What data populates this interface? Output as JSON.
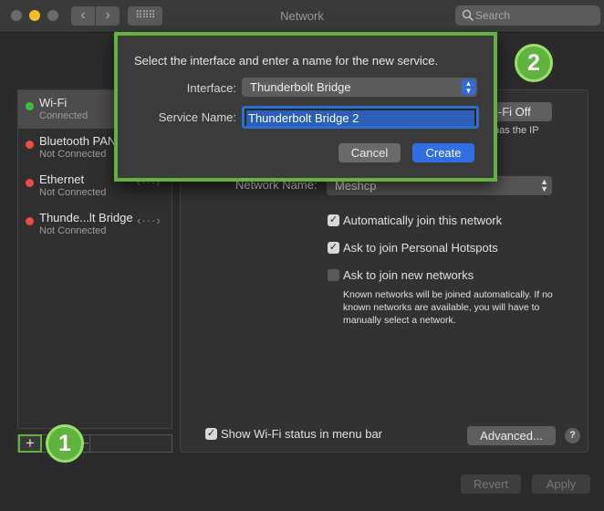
{
  "window": {
    "title": "Network",
    "search_placeholder": "Search"
  },
  "toolbar": {
    "back_glyph": "‹",
    "forward_glyph": "›",
    "grid_glyph": "⠿⠿⠿"
  },
  "sidebar": {
    "items": [
      {
        "name": "Wi-Fi",
        "status": "Connected",
        "status_color": "#36c240",
        "selected": true
      },
      {
        "name": "Bluetooth PAN",
        "status": "Not Connected",
        "status_color": "#ef4a44"
      },
      {
        "name": "Ethernet",
        "status": "Not Connected",
        "status_color": "#ef4a44",
        "icon": "ethernet-arrows-icon"
      },
      {
        "name": "Thunde...lt Bridge",
        "status": "Not Connected",
        "status_color": "#ef4a44",
        "icon": "ethernet-arrows-icon"
      }
    ],
    "add_glyph": "+",
    "remove_glyph": "−"
  },
  "callouts": {
    "one": "1",
    "two": "2"
  },
  "dialog": {
    "prompt": "Select the interface and enter a name for the new service.",
    "interface_label": "Interface:",
    "interface_value": "Thunderbolt Bridge",
    "service_name_label": "Service Name:",
    "service_name_value": "Thunderbolt Bridge 2",
    "cancel_label": "Cancel",
    "create_label": "Create"
  },
  "main": {
    "wifi_off_label": "i-Fi Off",
    "partial_status": "has the IP",
    "network_name_label": "Network Name:",
    "network_name_value": "Meshcp",
    "checkboxes": [
      {
        "label": "Automatically join this network",
        "checked": true
      },
      {
        "label": "Ask to join Personal Hotspots",
        "checked": true
      },
      {
        "label": "Ask to join new networks",
        "checked": false
      }
    ],
    "note": "Known networks will be joined automatically. If no known networks are available, you will have to manually select a network.",
    "show_status_label": "Show Wi-Fi status in menu bar",
    "show_status_checked": true,
    "advanced_label": "Advanced...",
    "help_label": "?"
  },
  "footer": {
    "revert_label": "Revert",
    "apply_label": "Apply"
  },
  "colors": {
    "accent_green": "#5fb33e",
    "selection_blue": "#2c6fd1",
    "create_blue": "#2f6fe3"
  }
}
